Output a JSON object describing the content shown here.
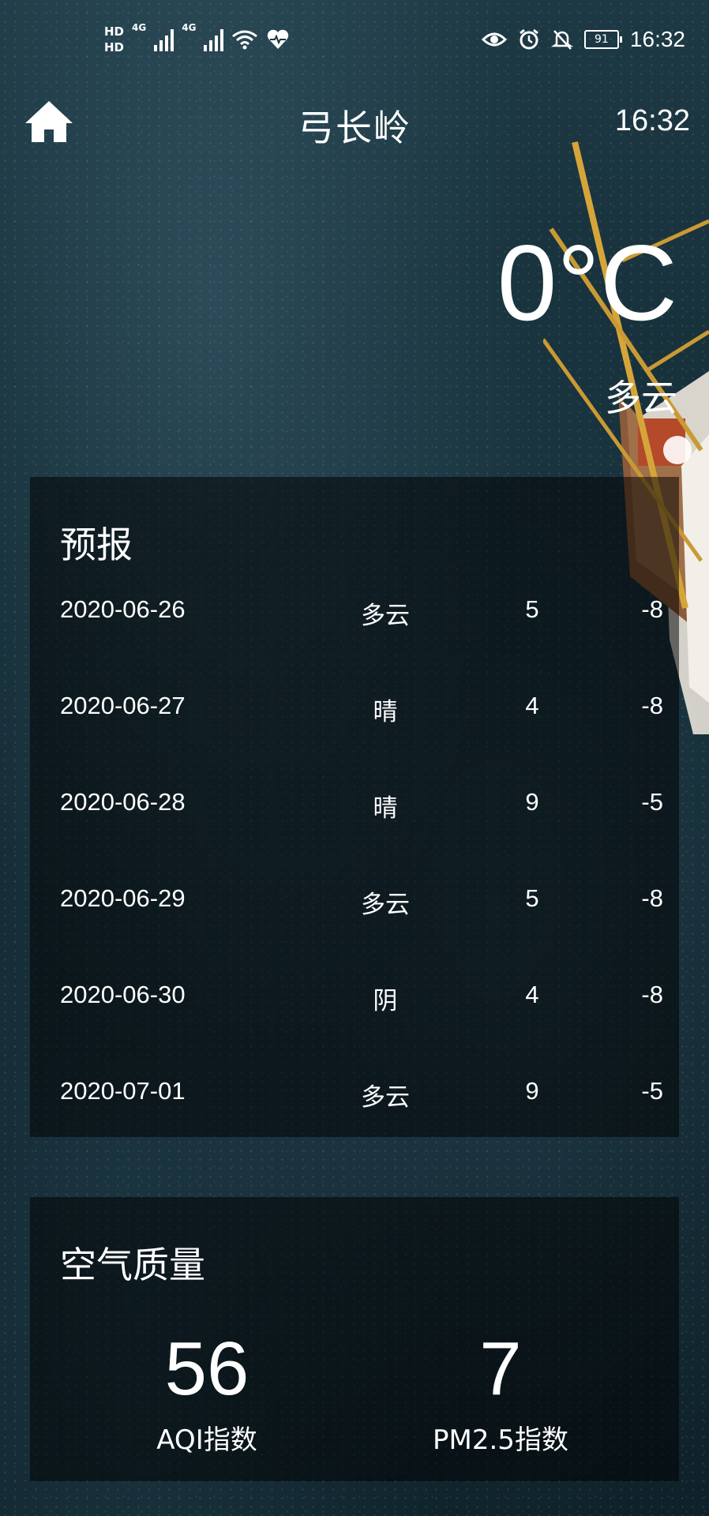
{
  "status_bar": {
    "time": "16:32",
    "battery": "91",
    "net_left_1": "HD",
    "net_left_2": "HD",
    "net_type": "4G",
    "icons": [
      "hd-icon",
      "signal-icon",
      "wifi-icon",
      "heart-icon",
      "eye-icon",
      "alarm-icon",
      "mute-icon",
      "battery-icon"
    ]
  },
  "header": {
    "city": "弓长岭",
    "update_time": "16:32",
    "home_icon": "home-icon"
  },
  "now": {
    "temperature": "0°C",
    "condition": "多云"
  },
  "forecast": {
    "title": "预报",
    "days": [
      {
        "date": "2020-06-26",
        "condition": "多云",
        "max": "5",
        "min": "-8"
      },
      {
        "date": "2020-06-27",
        "condition": "晴",
        "max": "4",
        "min": "-8"
      },
      {
        "date": "2020-06-28",
        "condition": "晴",
        "max": "9",
        "min": "-5"
      },
      {
        "date": "2020-06-29",
        "condition": "多云",
        "max": "5",
        "min": "-8"
      },
      {
        "date": "2020-06-30",
        "condition": "阴",
        "max": "4",
        "min": "-8"
      },
      {
        "date": "2020-07-01",
        "condition": "多云",
        "max": "9",
        "min": "-5"
      }
    ]
  },
  "air_quality": {
    "title": "空气质量",
    "aqi_value": "56",
    "aqi_label": "AQI指数",
    "pm25_value": "7",
    "pm25_label": "PM2.5指数"
  }
}
